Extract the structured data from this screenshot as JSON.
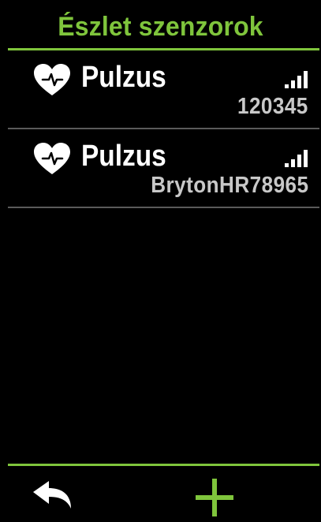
{
  "header": {
    "title": "Észlet szenzorok"
  },
  "sensors": [
    {
      "name": "Pulzus",
      "id": "120345",
      "icon": "heart-rate-icon",
      "signal_icon": "signal-strength-icon"
    },
    {
      "name": "Pulzus",
      "id": "BrytonHR78965",
      "icon": "heart-rate-icon",
      "signal_icon": "signal-strength-icon"
    }
  ],
  "footer": {
    "back_icon": "back-arrow-icon",
    "add_icon": "plus-icon"
  },
  "colors": {
    "accent": "#7fc53c",
    "background": "#000000",
    "text": "#ffffff",
    "divider": "#5a5a5a"
  }
}
